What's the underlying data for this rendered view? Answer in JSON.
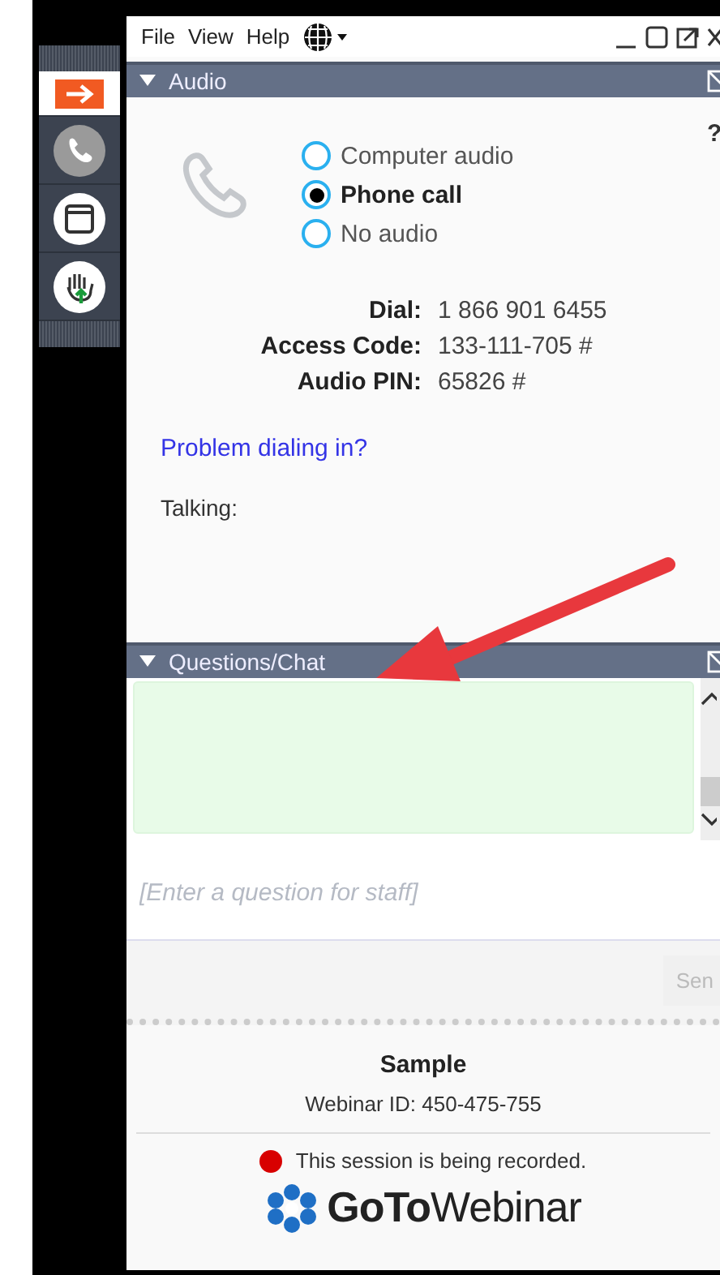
{
  "menu": [
    "File",
    "View",
    "Help"
  ],
  "sidebar": {
    "items": [
      {
        "kind": "arrow",
        "selected": true
      },
      {
        "kind": "phone",
        "selected": false
      },
      {
        "kind": "window",
        "selected": false
      },
      {
        "kind": "hand",
        "selected": false
      }
    ]
  },
  "audio": {
    "title": "Audio",
    "help": "?",
    "options": [
      {
        "label": "Computer audio",
        "selected": false
      },
      {
        "label": "Phone call",
        "selected": true
      },
      {
        "label": "No audio",
        "selected": false
      }
    ],
    "dial": [
      {
        "label": "Dial:",
        "value": "1 866 901 6455"
      },
      {
        "label": "Access Code:",
        "value": "133-111-705 #"
      },
      {
        "label": "Audio PIN:",
        "value": "65826 #"
      }
    ],
    "problem_link": "Problem dialing in?",
    "talking_label": "Talking:"
  },
  "chat": {
    "title": "Questions/Chat",
    "placeholder": "[Enter a question for staff]",
    "send": "Sen"
  },
  "footer": {
    "title": "Sample",
    "webinar_id": "Webinar ID: 450-475-755",
    "recording": "This session is being recorded.",
    "brand": "**GoTo**Webinar"
  }
}
